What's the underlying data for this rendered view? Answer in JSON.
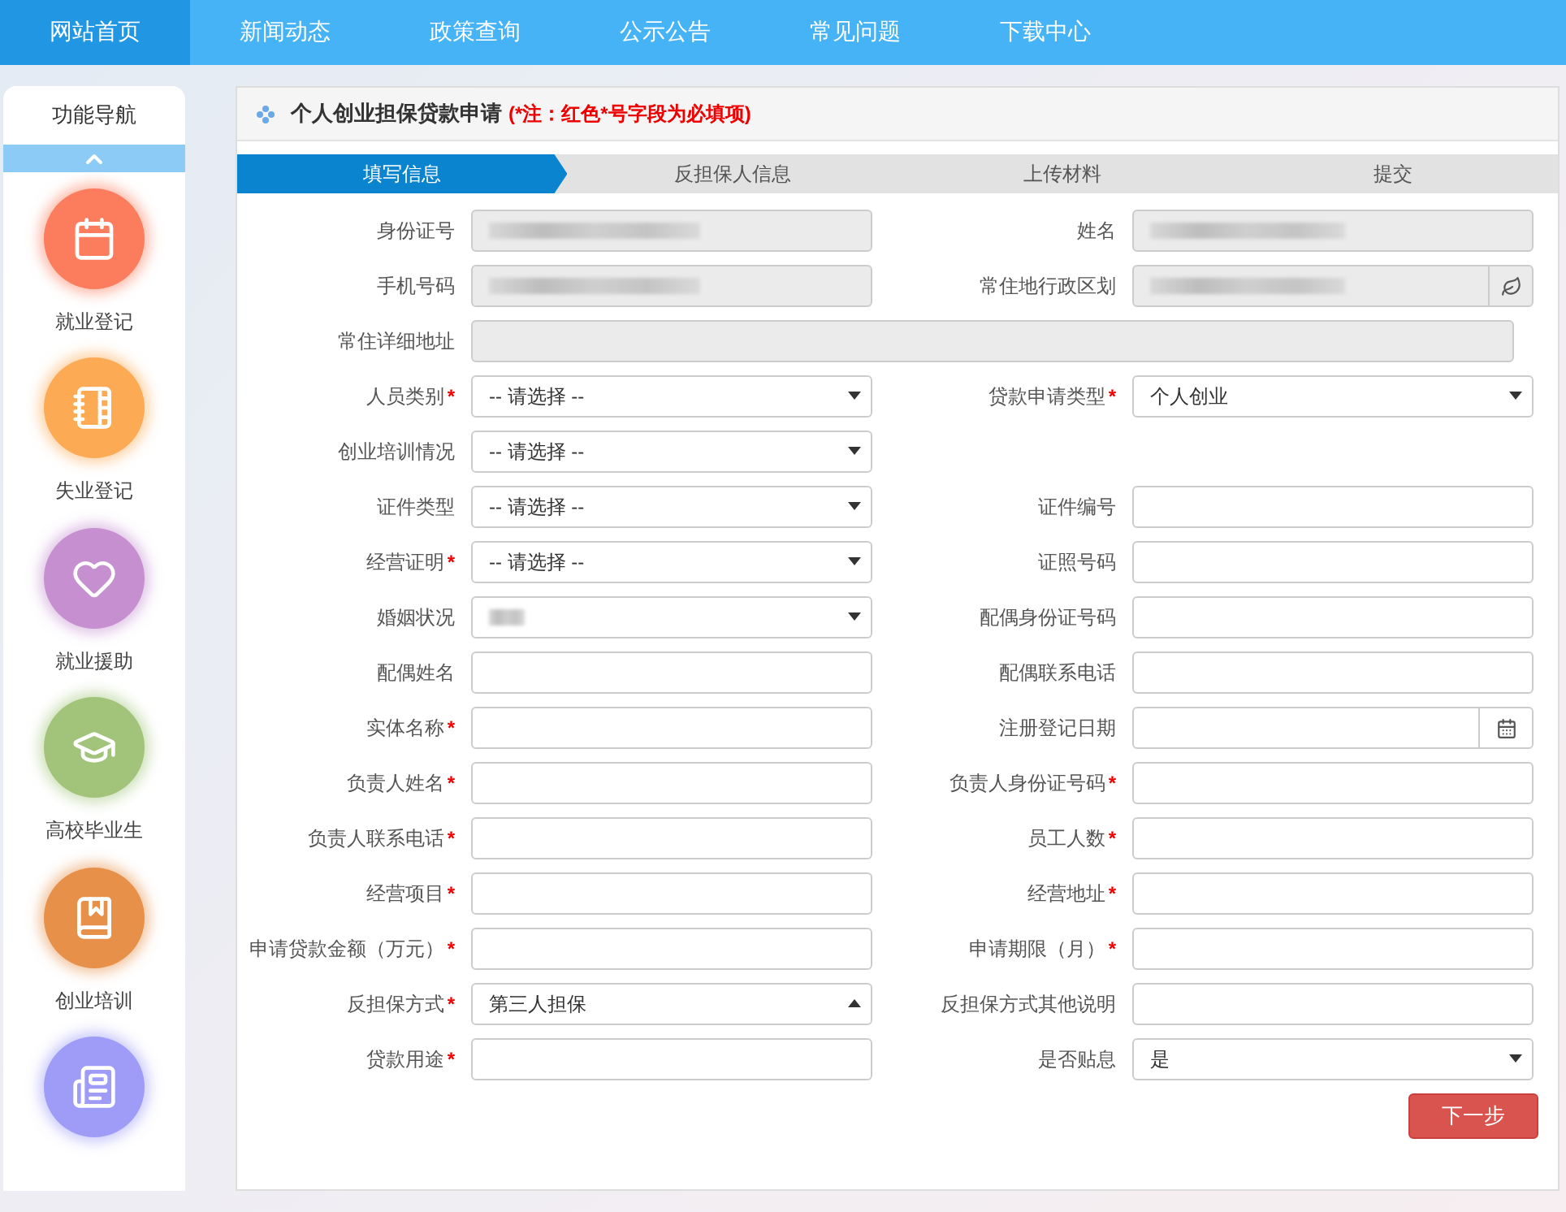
{
  "nav": {
    "items": [
      {
        "label": "网站首页",
        "selected": true
      },
      {
        "label": "新闻动态",
        "selected": false
      },
      {
        "label": "政策查询",
        "selected": false
      },
      {
        "label": "公示公告",
        "selected": false
      },
      {
        "label": "常见问题",
        "selected": false
      },
      {
        "label": "下载中心",
        "selected": false
      }
    ]
  },
  "sidebar": {
    "title": "功能导航",
    "items": [
      {
        "label": "就业登记",
        "color": "#fb7d5d"
      },
      {
        "label": "失业登记",
        "color": "#fdaa55"
      },
      {
        "label": "就业援助",
        "color": "#c58fd0"
      },
      {
        "label": "高校毕业生",
        "color": "#a2c47a"
      },
      {
        "label": "创业培训",
        "color": "#e7904a"
      },
      {
        "color": "#9e9cf7"
      }
    ]
  },
  "panel": {
    "title": "个人创业担保贷款申请",
    "note": "(*注：红色*号字段为必填项)"
  },
  "steps": [
    {
      "label": "填写信息",
      "selected": true
    },
    {
      "label": "反担保人信息",
      "selected": false
    },
    {
      "label": "上传材料",
      "selected": false
    },
    {
      "label": "提交",
      "selected": false
    }
  ],
  "rows": [
    [
      {
        "label": "身份证号",
        "required": false,
        "kind": "text",
        "disabled": true,
        "redacted": true
      },
      {
        "label": "姓名",
        "required": false,
        "kind": "text",
        "disabled": true,
        "redacted": true
      }
    ],
    [
      {
        "label": "手机号码",
        "required": false,
        "kind": "text",
        "disabled": true,
        "redacted": true
      },
      {
        "label": "常住地行政区划",
        "required": false,
        "kind": "region",
        "disabled": true,
        "redacted": true
      }
    ],
    [
      {
        "label": "常住详细地址",
        "required": false,
        "kind": "wide",
        "disabled": true,
        "redacted": false
      }
    ],
    [
      {
        "label": "人员类别",
        "required": true,
        "kind": "select",
        "value": "-- 请选择 --",
        "open": false,
        "disabled": false,
        "redacted": false
      },
      {
        "label": "贷款申请类型",
        "required": true,
        "kind": "select",
        "value": "个人创业",
        "open": false,
        "disabled": false,
        "redacted": false
      }
    ],
    [
      {
        "label": "创业培训情况",
        "required": false,
        "kind": "select",
        "value": "-- 请选择 --",
        "open": false,
        "disabled": false,
        "redacted": false
      }
    ],
    [
      {
        "label": "证件类型",
        "required": false,
        "kind": "select",
        "value": "-- 请选择 --",
        "open": false,
        "disabled": false,
        "redacted": false
      },
      {
        "label": "证件编号",
        "required": false,
        "kind": "text",
        "disabled": false,
        "redacted": false
      }
    ],
    [
      {
        "label": "经营证明",
        "required": true,
        "kind": "select",
        "value": "-- 请选择 --",
        "open": false,
        "disabled": false,
        "redacted": false
      },
      {
        "label": "证照号码",
        "required": false,
        "kind": "text",
        "disabled": false,
        "redacted": false
      }
    ],
    [
      {
        "label": "婚姻状况",
        "required": false,
        "kind": "select",
        "open": false,
        "disabled": false,
        "redacted": true
      },
      {
        "label": "配偶身份证号码",
        "required": false,
        "kind": "text",
        "disabled": false,
        "redacted": false
      }
    ],
    [
      {
        "label": "配偶姓名",
        "required": false,
        "kind": "text",
        "disabled": false,
        "redacted": false
      },
      {
        "label": "配偶联系电话",
        "required": false,
        "kind": "text",
        "disabled": false,
        "redacted": false
      }
    ],
    [
      {
        "label": "实体名称",
        "required": true,
        "kind": "text",
        "disabled": false,
        "redacted": false
      },
      {
        "label": "注册登记日期",
        "required": false,
        "kind": "date",
        "disabled": false,
        "redacted": false
      }
    ],
    [
      {
        "label": "负责人姓名",
        "required": true,
        "kind": "text",
        "disabled": false,
        "redacted": false
      },
      {
        "label": "负责人身份证号码",
        "required": true,
        "kind": "text",
        "disabled": false,
        "redacted": false
      }
    ],
    [
      {
        "label": "负责人联系电话",
        "required": true,
        "kind": "text",
        "disabled": false,
        "redacted": false
      },
      {
        "label": "员工人数",
        "required": true,
        "kind": "text",
        "disabled": false,
        "redacted": false
      }
    ],
    [
      {
        "label": "经营项目",
        "required": true,
        "kind": "text",
        "disabled": false,
        "redacted": false
      },
      {
        "label": "经营地址",
        "required": true,
        "kind": "text",
        "disabled": false,
        "redacted": false
      }
    ],
    [
      {
        "label": "申请贷款金额（万元）",
        "required": true,
        "kind": "text",
        "disabled": false,
        "redacted": false
      },
      {
        "label": "申请期限（月）",
        "required": true,
        "kind": "text",
        "disabled": false,
        "redacted": false
      }
    ],
    [
      {
        "label": "反担保方式",
        "required": true,
        "kind": "select",
        "value": "第三人担保",
        "open": true,
        "disabled": false,
        "redacted": false
      },
      {
        "label": "反担保方式其他说明",
        "required": false,
        "kind": "text",
        "disabled": false,
        "redacted": false
      }
    ],
    [
      {
        "label": "贷款用途",
        "required": true,
        "kind": "text",
        "disabled": false,
        "redacted": false
      },
      {
        "label": "是否贴息",
        "required": false,
        "kind": "select",
        "value": "是",
        "open": false,
        "disabled": false,
        "redacted": false
      }
    ]
  ],
  "required_mark": "*",
  "next_button": "下一步"
}
